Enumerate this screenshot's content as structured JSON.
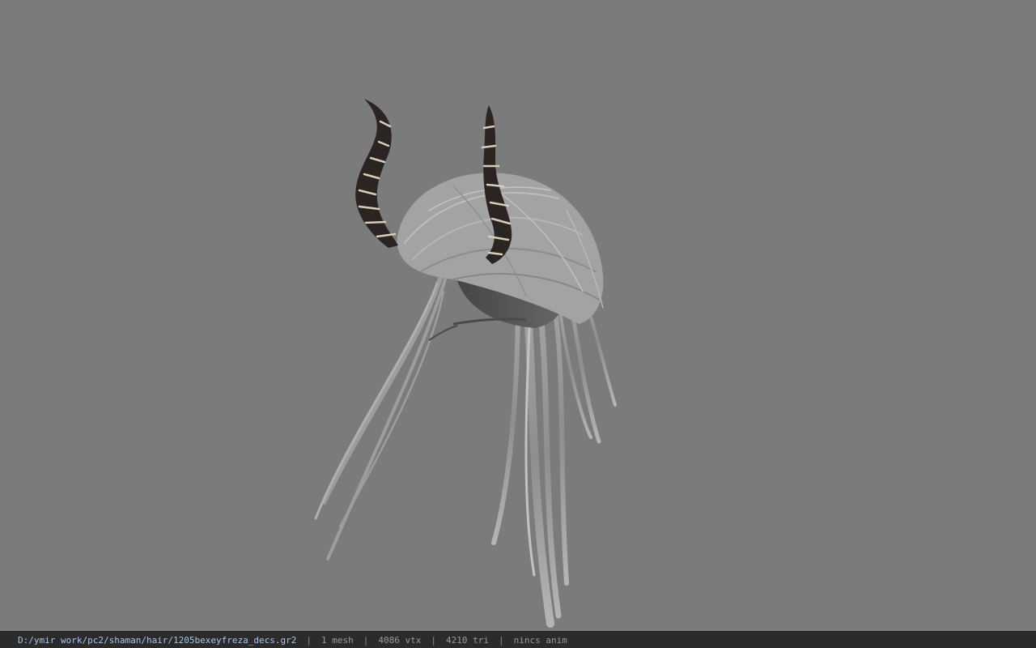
{
  "status": {
    "file_path": "D:/ymir work/pc2/shaman/hair/1205bexeyfreza_decs.gr2",
    "separator": "|",
    "mesh_count": "1 mesh",
    "vertex_count": "4086 vtx",
    "triangle_count": "4210 tri",
    "anim": "nincs anim"
  },
  "viewport": {
    "background": "#7b7b7b",
    "hair_color": "#9a9a9a",
    "horn_color": "#2a2522",
    "horn_stripe_color": "#d8cdb8"
  }
}
